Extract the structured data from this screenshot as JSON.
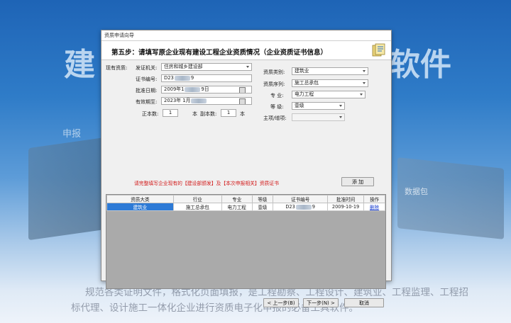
{
  "background": {
    "title_left": "建",
    "title_right": "软件",
    "package_label": "申报",
    "package_label2": "数据包",
    "description_line1": "规范各类证明文件，格式化页面填报，是工程勘察、工程设计、建筑业、工程监理、工程招",
    "description_line2": "标代理、设计施工一体化企业进行资质电子化申报的必备工具软件。"
  },
  "dialog": {
    "window_title": "资质申请向导",
    "step_title": "第五步：请填写原企业现有建设工程企业资质情况（企业资质证书信息）",
    "form": {
      "existing_label": "现有资质:",
      "issuer_label": "发证机关:",
      "issuer_value": "住房和城乡建设部",
      "cert_no_label": "证书编号:",
      "cert_no_prefix": "D23",
      "cert_no_suffix": "9",
      "approve_date_label": "批准日期:",
      "approve_date_prefix": "2009年1",
      "approve_date_suffix": "9日",
      "valid_until_label": "有效期至:",
      "valid_until_prefix": "2023年 1月",
      "valid_until_suffix": "",
      "original_copies_label": "正本数:",
      "original_copies_value": "1",
      "copy_label_1": "本",
      "duplicate_copies_label": "副本数:",
      "duplicate_copies_value": "1",
      "copy_label_2": "本",
      "qual_type_label": "资质类别:",
      "qual_type_value": "建筑业",
      "qual_series_label": "资质序列:",
      "qual_series_value": "施工总承包",
      "specialty_label": "专   业:",
      "specialty_value": "电力工程",
      "grade_label": "等   级:",
      "grade_value": "壹级",
      "main_add_label": "主项/增项:",
      "main_add_value": "",
      "warning": "请完整填写企业现有的【建设部颁发】及【本次申报相关】资质证书",
      "add_button": "添 加"
    },
    "table": {
      "headers": [
        "资质大类",
        "行业",
        "专业",
        "等级",
        "证书编号",
        "批准时间",
        "操作"
      ],
      "rows": [
        {
          "category": "建筑业",
          "industry": "施工总承包",
          "specialty": "电力工程",
          "grade": "壹级",
          "cert_prefix": "D23",
          "cert_suffix": "9",
          "approve_time": "2009-10-19",
          "action": "删除"
        }
      ]
    },
    "buttons": {
      "prev": "< 上一步(B)",
      "next": "下一步(N) >",
      "cancel": "取消"
    }
  },
  "colors": {
    "selected_cell": "#2d7ad6",
    "warning_text": "#d21a1a",
    "link": "#1a3fd0"
  }
}
